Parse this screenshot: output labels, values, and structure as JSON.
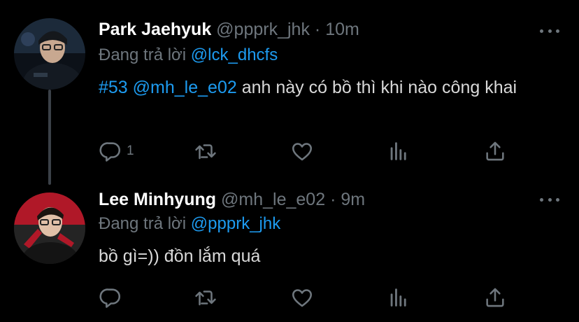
{
  "tweets": [
    {
      "author": "Park Jaehyuk",
      "handle": "@ppprk_jhk",
      "separator": "·",
      "time": "10m",
      "reply_prefix": "Đang trả lời",
      "reply_to": "@lck_dhcfs",
      "hashtag": "#53",
      "mention": "@mh_le_e02",
      "text": "anh này có bồ thì khi nào công khai",
      "reply_count": "1",
      "icons": [
        "reply-icon",
        "retweet-icon",
        "like-icon",
        "analytics-icon",
        "share-icon"
      ],
      "avatar_colors": [
        "#1c2a3a",
        "#0c1118",
        "#c8a890"
      ]
    },
    {
      "author": "Lee Minhyung",
      "handle": "@mh_le_e02",
      "separator": "·",
      "time": "9m",
      "reply_prefix": "Đang trả lời",
      "reply_to": "@ppprk_jhk",
      "text": "bồ gì=)) đồn lắm quá",
      "reply_count": "",
      "icons": [
        "reply-icon",
        "retweet-icon",
        "like-icon",
        "analytics-icon",
        "share-icon"
      ],
      "avatar_colors": [
        "#b01828",
        "#1a1a1a",
        "#e0c0a8"
      ]
    }
  ],
  "colors": {
    "background": "#000000",
    "name": "#ffffff",
    "secondary": "#6e767d",
    "link": "#1d9bf0",
    "body": "#d9d9d9",
    "thread_line": "#3b4148"
  }
}
